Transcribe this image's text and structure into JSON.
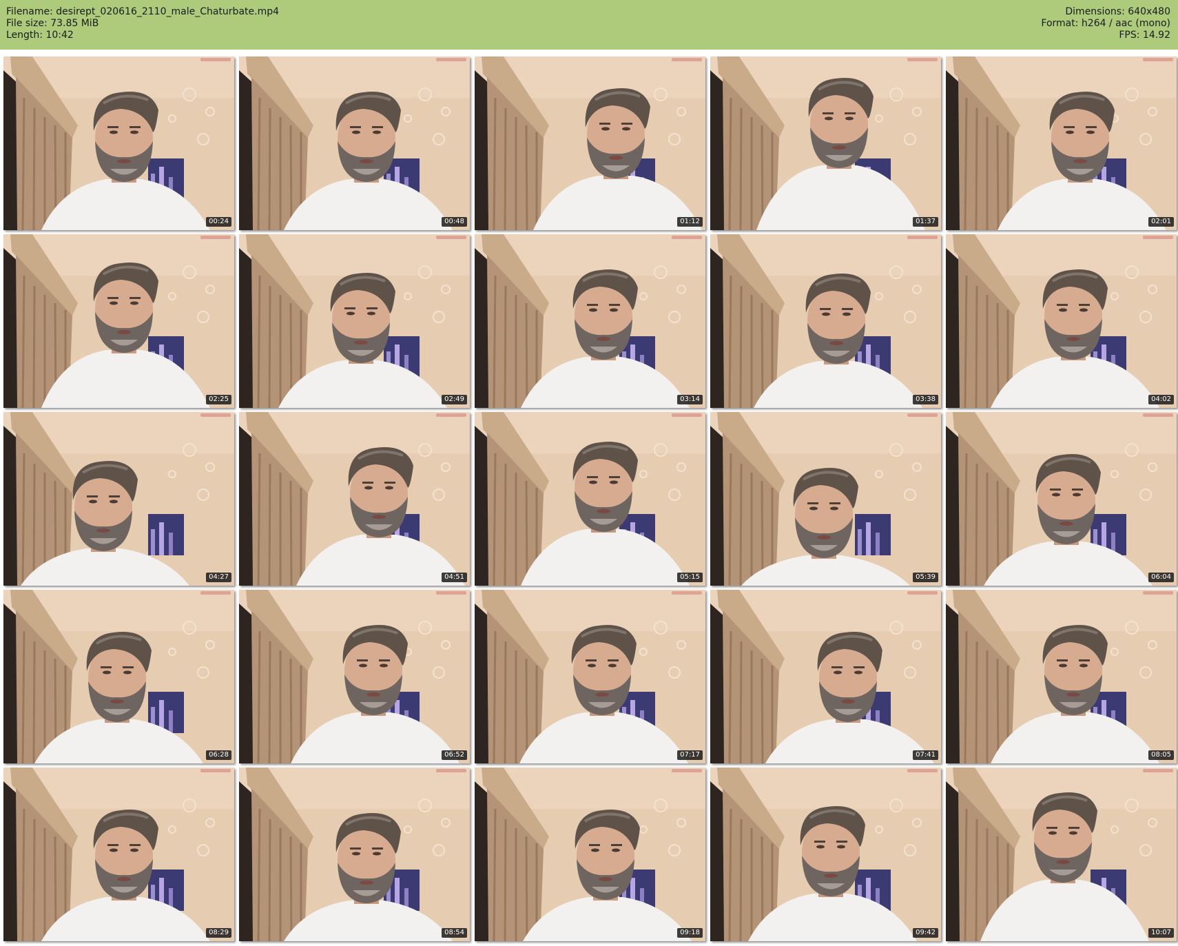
{
  "header": {
    "filename": "Filename: desirept_020616_2110_male_Chaturbate.mp4",
    "file_size": "File size: 73.85 MiB",
    "length": "Length: 10:42",
    "dimensions": "Dimensions: 640x480",
    "format": "Format: h264 / aac (mono)",
    "fps": "FPS: 14.92"
  },
  "colors": {
    "header_bg": "#aecb7c",
    "timestamp_bg": "#141414",
    "wall": "#e3c9ad"
  },
  "thumbnails": [
    {
      "time": "00:24"
    },
    {
      "time": "00:48"
    },
    {
      "time": "01:12"
    },
    {
      "time": "01:37"
    },
    {
      "time": "02:01"
    },
    {
      "time": "02:25"
    },
    {
      "time": "02:49"
    },
    {
      "time": "03:14"
    },
    {
      "time": "03:38"
    },
    {
      "time": "04:02"
    },
    {
      "time": "04:27"
    },
    {
      "time": "04:51"
    },
    {
      "time": "05:15"
    },
    {
      "time": "05:39"
    },
    {
      "time": "06:04"
    },
    {
      "time": "06:28"
    },
    {
      "time": "06:52"
    },
    {
      "time": "07:17"
    },
    {
      "time": "07:41"
    },
    {
      "time": "08:05"
    },
    {
      "time": "08:29"
    },
    {
      "time": "08:54"
    },
    {
      "time": "09:18"
    },
    {
      "time": "09:42"
    },
    {
      "time": "10:07"
    }
  ]
}
